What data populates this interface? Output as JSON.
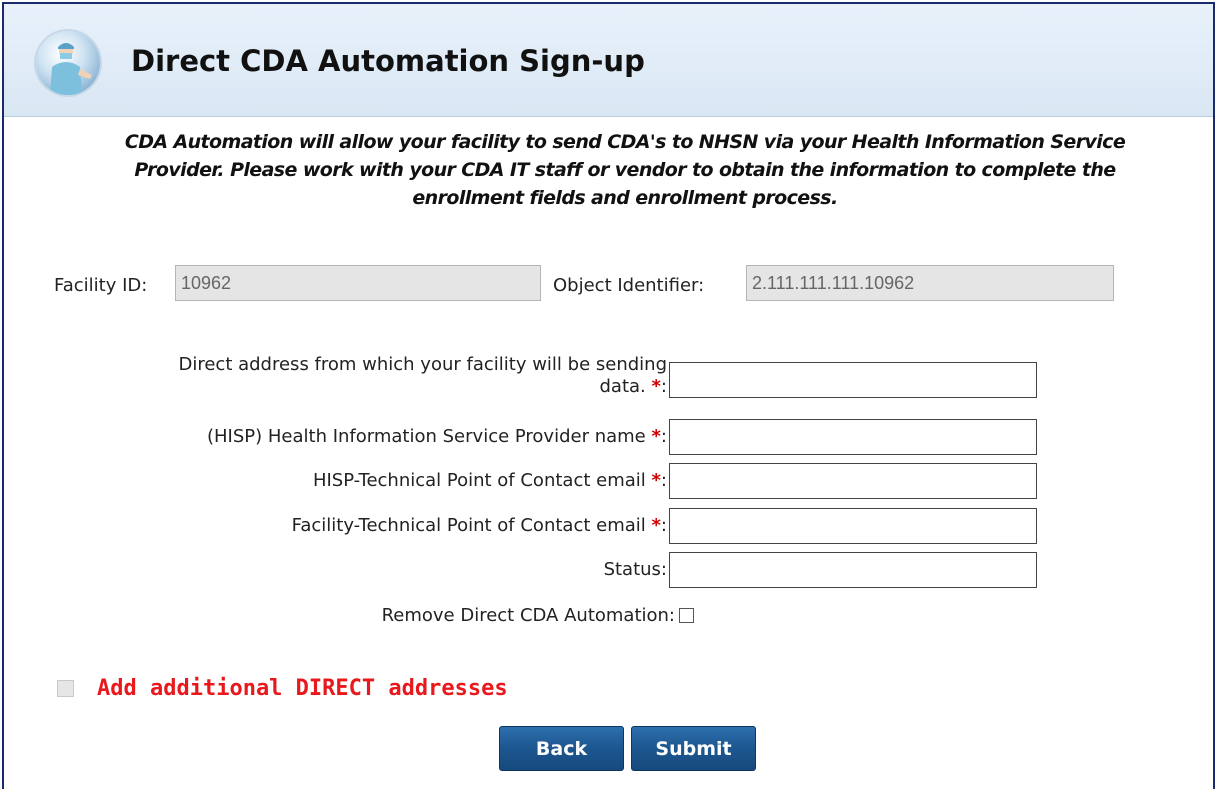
{
  "header": {
    "title": "Direct CDA Automation Sign-up",
    "logo_icon": "clinician-logo-icon"
  },
  "intro": {
    "line1": "CDA Automation will allow your facility to send CDA's to NHSN via your Health Information Service",
    "line2": "Provider. Please work with your CDA IT staff or vendor to obtain the information to complete the",
    "line3": "enrollment fields and enrollment process."
  },
  "facility": {
    "id_label": "Facility ID:",
    "id_value": "10962",
    "oid_label": "Object Identifier:",
    "oid_value": "2.111.111.111.10962"
  },
  "form": {
    "direct_address_label_line1": "Direct address from which your facility will be sending",
    "direct_address_label_line2": "data.",
    "hisp_name_label": "(HISP) Health Information Service Provider name",
    "hisp_contact_label": "HISP-Technical Point of Contact email",
    "facility_contact_label": "Facility-Technical Point of Contact email",
    "status_label": "Status:",
    "remove_label": "Remove Direct CDA Automation:",
    "required_mark": "*",
    "colon": ":",
    "direct_address_value": "",
    "hisp_name_value": "",
    "hisp_contact_value": "",
    "facility_contact_value": "",
    "status_value": ""
  },
  "additional": {
    "label": "Add additional DIRECT addresses"
  },
  "buttons": {
    "back": "Back",
    "submit": "Submit"
  },
  "colors": {
    "header_bg": "#dde9f5",
    "required": "#d00000",
    "add_link": "#e8181c",
    "button": "#1d568f"
  }
}
